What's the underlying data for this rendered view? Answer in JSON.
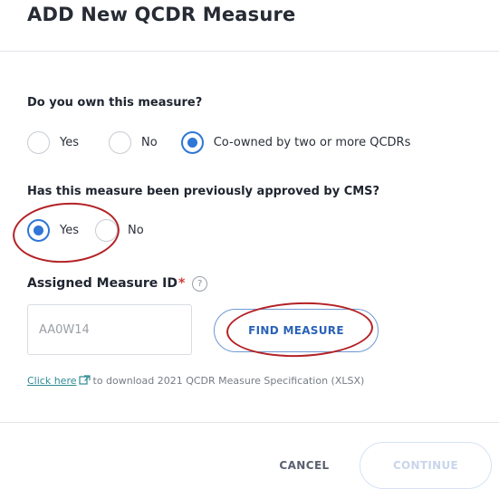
{
  "dialog": {
    "title": "ADD New QCDR Measure"
  },
  "ownership": {
    "question": "Do you own this measure?",
    "options": [
      "Yes",
      "No",
      "Co-owned by two or more QCDRs"
    ],
    "selected": "Co-owned by two or more QCDRs"
  },
  "approval": {
    "question": "Has this measure been previously approved by CMS?",
    "options": [
      "Yes",
      "No"
    ],
    "selected": "Yes"
  },
  "measure_id": {
    "label": "Assigned Measure ID",
    "required_mark": "*",
    "help_icon": "?",
    "value": "AA0W14",
    "find_button_label": "FIND MEASURE"
  },
  "download": {
    "link_text": "Click here",
    "rest_text": "to download 2021 QCDR Measure Specification (XLSX)",
    "link_icon": "external-link-icon"
  },
  "footer": {
    "cancel_label": "CANCEL",
    "continue_label": "CONTINUE"
  },
  "colors": {
    "accent": "#2f76d6",
    "annotation": "#b42226",
    "link": "#2f8a94"
  }
}
